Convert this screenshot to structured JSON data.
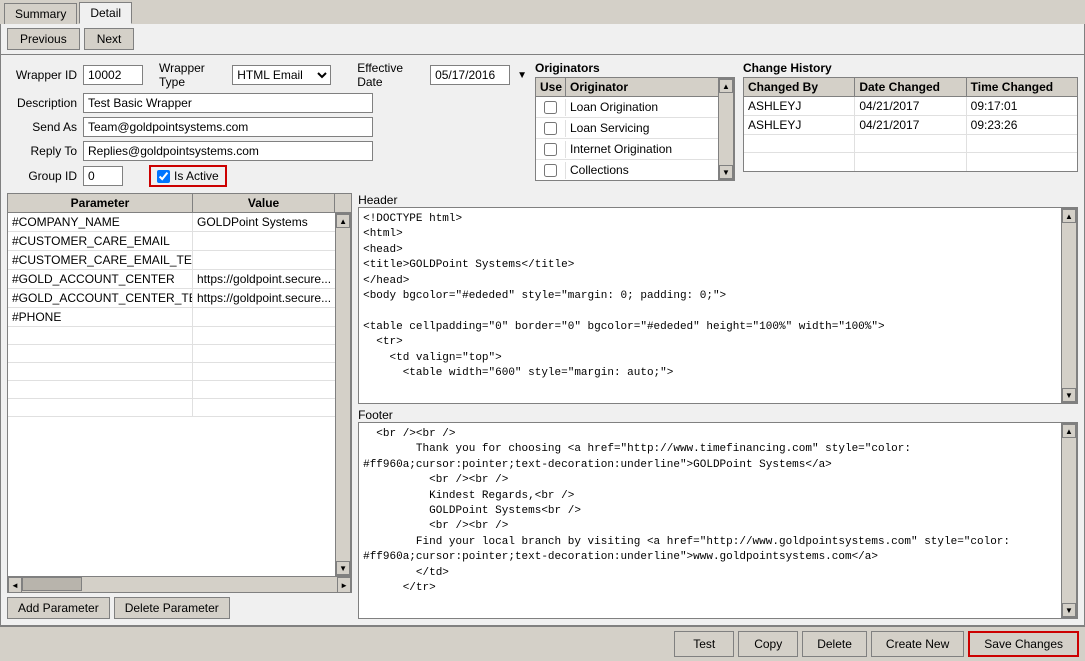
{
  "tabs": [
    {
      "label": "Summary",
      "active": false
    },
    {
      "label": "Detail",
      "active": true
    }
  ],
  "nav": {
    "previous_label": "Previous",
    "next_label": "Next"
  },
  "form": {
    "wrapper_id": "10002",
    "wrapper_type": "HTML Email",
    "effective_date": "05/17/2016",
    "description": "Test Basic Wrapper",
    "send_as": "Team@goldpointsystems.com",
    "reply_to": "Replies@goldpointsystems.com",
    "group_id": "0",
    "is_active": true,
    "labels": {
      "wrapper_id": "Wrapper ID",
      "wrapper_type": "Wrapper Type",
      "effective_date": "Effective Date",
      "description": "Description",
      "send_as": "Send As",
      "reply_to": "Reply To",
      "group_id": "Group ID",
      "is_active": "Is Active"
    }
  },
  "originators": {
    "title": "Originators",
    "headers": [
      "Use",
      "Originator"
    ],
    "items": [
      {
        "use": false,
        "name": "Loan Origination"
      },
      {
        "use": false,
        "name": "Loan Servicing"
      },
      {
        "use": false,
        "name": "Internet Origination"
      },
      {
        "use": false,
        "name": "Collections"
      }
    ]
  },
  "change_history": {
    "title": "Change History",
    "headers": [
      "Changed By",
      "Date Changed",
      "Time Changed"
    ],
    "rows": [
      {
        "changed_by": "ASHLEYJ",
        "date_changed": "04/21/2017",
        "time_changed": "09:17:01"
      },
      {
        "changed_by": "ASHLEYJ",
        "date_changed": "04/21/2017",
        "time_changed": "09:23:26"
      }
    ]
  },
  "parameters": {
    "headers": [
      "Parameter",
      "Value"
    ],
    "rows": [
      {
        "parameter": "#COMPANY_NAME",
        "value": "GOLDPoint Systems"
      },
      {
        "parameter": "#CUSTOMER_CARE_EMAIL",
        "value": ""
      },
      {
        "parameter": "#CUSTOMER_CARE_EMAIL_TEXT",
        "value": ""
      },
      {
        "parameter": "#GOLD_ACCOUNT_CENTER",
        "value": "https://goldpoint.secure..."
      },
      {
        "parameter": "#GOLD_ACCOUNT_CENTER_TEXT",
        "value": "https://goldpoint.secure..."
      },
      {
        "parameter": "#PHONE",
        "value": ""
      }
    ],
    "add_label": "Add Parameter",
    "delete_label": "Delete Parameter"
  },
  "header_section": {
    "label": "Header",
    "content": "<!DOCTYPE html>\n<html>\n<head>\n<title>GOLDPoint Systems</title>\n</head>\n<body bgcolor=\"#ededed\" style=\"margin: 0; padding: 0;\">\n\n<table cellpadding=\"0\" border=\"0\" bgcolor=\"#ededed\" height=\"100%\" width=\"100%\">\n  <tr>\n    <td valign=\"top\">\n      <table width=\"600\" style=\"margin: auto;\">"
  },
  "footer_section": {
    "label": "Footer",
    "content": "  <br /><br />\n        Thank you for choosing <a href=\"http://www.timefinancing.com\" style=\"color: #ff960a;cursor:pointer;text-decoration:underline\">GOLDPoint Systems</a>\n          <br /><br />\n          Kindest Regards,<br />\n          GOLDPoint Systems<br />\n          <br /><br />\n        Find your local branch by visiting <a href=\"http://www.goldpointsystems.com\" style=\"color: #ff960a;cursor:pointer;text-decoration:underline\">www.goldpointsystems.com</a>\n        </td>\n      </tr>"
  },
  "bottom_buttons": {
    "test_label": "Test",
    "copy_label": "Copy",
    "delete_label": "Delete",
    "create_new_label": "Create New",
    "save_changes_label": "Save Changes"
  }
}
